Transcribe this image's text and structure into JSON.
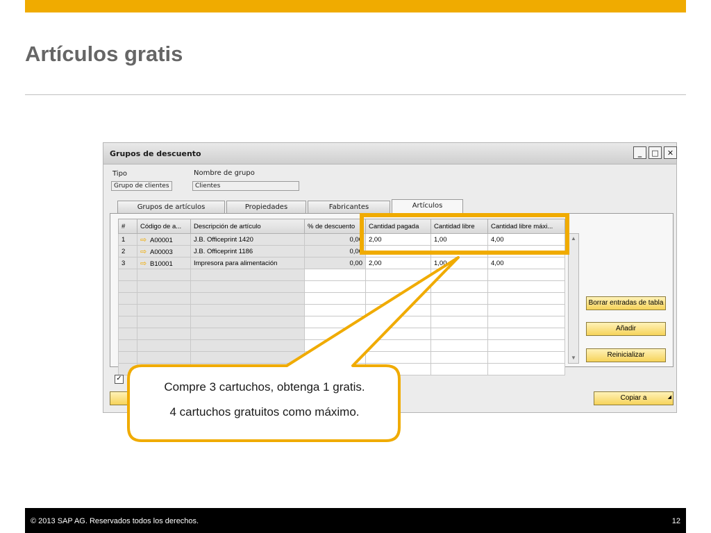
{
  "slide": {
    "title": "Artículos gratis",
    "accent_color": "#f0ab00",
    "footer_copyright": "© 2013 SAP AG. Reservados todos los derechos.",
    "page_number": "12"
  },
  "window": {
    "title": "Grupos de descuento",
    "minimize_icon": "minimize-icon",
    "maximize_icon": "maximize-icon",
    "close_icon": "close-icon"
  },
  "header_fields": {
    "tipo_label": "Tipo",
    "tipo_value": "Grupo de clientes",
    "nombre_label": "Nombre de grupo",
    "nombre_value": "Clientes"
  },
  "tabs": [
    {
      "label": "Grupos de artículos",
      "active": false
    },
    {
      "label": "Propiedades",
      "active": false
    },
    {
      "label": "Fabricantes",
      "active": false
    },
    {
      "label": "Artículos",
      "active": true
    }
  ],
  "grid": {
    "columns": [
      "#",
      "Código de a...",
      "Descripción de artículo",
      "% de descuento",
      "Cantidad pagada",
      "Cantidad libre",
      "Cantidad libre máxi..."
    ],
    "rows": [
      {
        "num": "1",
        "code": "A00001",
        "desc": "J.B. Officeprint 1420",
        "discount": "0,00",
        "paid": "2,00",
        "free": "1,00",
        "max_free": "4,00"
      },
      {
        "num": "2",
        "code": "A00003",
        "desc": "J.B. Officeprint 1186",
        "discount": "0,00",
        "paid": "",
        "free": "",
        "max_free": ""
      },
      {
        "num": "3",
        "code": "B10001",
        "desc": "Impresora para alimentación",
        "discount": "0,00",
        "paid": "2,00",
        "free": "1,00",
        "max_free": "4,00"
      }
    ]
  },
  "buttons": {
    "borrar": "Borrar entradas de tabla",
    "anadir": "Añadir",
    "reinicializar": "Reinicializar",
    "copiar": "Copiar a"
  },
  "callout": {
    "line1": "Compre 3 cartuchos, obtenga 1 gratis.",
    "line2": "4 cartuchos gratuitos como máximo."
  }
}
